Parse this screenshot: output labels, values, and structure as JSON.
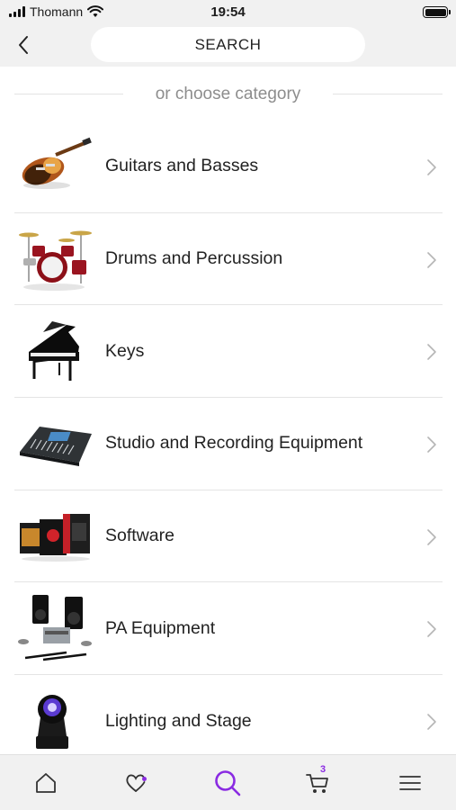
{
  "status_bar": {
    "carrier": "Thomann",
    "time": "19:54",
    "icons": [
      "signal-icon",
      "wifi-icon",
      "battery-icon"
    ]
  },
  "header": {
    "back_icon": "chevron-left-icon",
    "search_label": "SEARCH"
  },
  "divider": {
    "label": "or choose category"
  },
  "categories": [
    {
      "label": "Guitars and Basses",
      "icon": "guitar-thumbnail"
    },
    {
      "label": "Drums and Percussion",
      "icon": "drum-kit-thumbnail"
    },
    {
      "label": "Keys",
      "icon": "grand-piano-thumbnail"
    },
    {
      "label": "Studio and Recording Equipment",
      "icon": "mixing-console-thumbnail"
    },
    {
      "label": "Software",
      "icon": "software-boxes-thumbnail"
    },
    {
      "label": "PA Equipment",
      "icon": "pa-speakers-thumbnail"
    },
    {
      "label": "Lighting and Stage",
      "icon": "moving-head-light-thumbnail"
    }
  ],
  "bottom_nav": {
    "items": [
      "home-icon",
      "wishlist-icon",
      "search-icon",
      "cart-icon",
      "menu-icon"
    ],
    "active": "search-icon",
    "cart_count": "3"
  },
  "colors": {
    "accent": "#8a2be2",
    "background": "#ffffff",
    "header_bg": "#f1f1f1"
  }
}
